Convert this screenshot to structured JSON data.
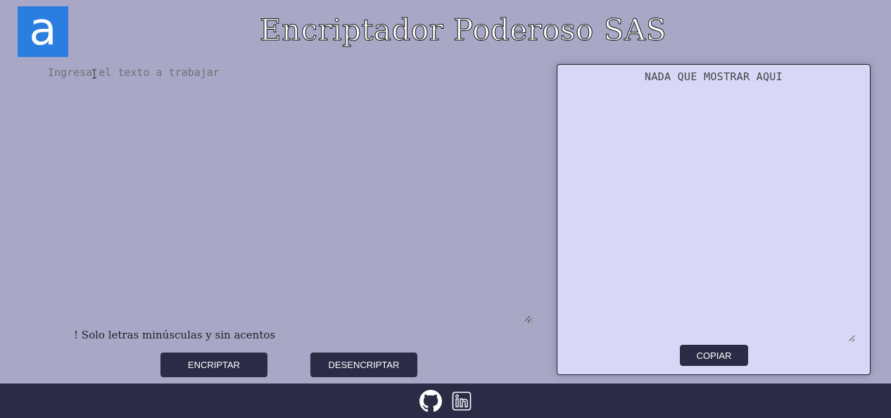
{
  "header": {
    "logo_letter": "a",
    "title": "Encriptador Poderoso SAS"
  },
  "input": {
    "placeholder": "Ingresa el texto a trabajar",
    "value": ""
  },
  "warning": "! Solo letras minúsculas y sin acentos",
  "buttons": {
    "encrypt": "ENCRIPTAR",
    "decrypt": "DESENCRIPTAR",
    "copy": "COPIAR"
  },
  "output": {
    "text": "NADA QUE MOSTRAR AQUI"
  },
  "footer": {
    "icons": [
      "github-icon",
      "linkedin-icon"
    ]
  },
  "colors": {
    "background": "#a8a8c6",
    "button": "#2c2b46",
    "logo": "#2a7ee0",
    "output_panel": "#d9d7f7",
    "footer": "#2c2b46"
  }
}
